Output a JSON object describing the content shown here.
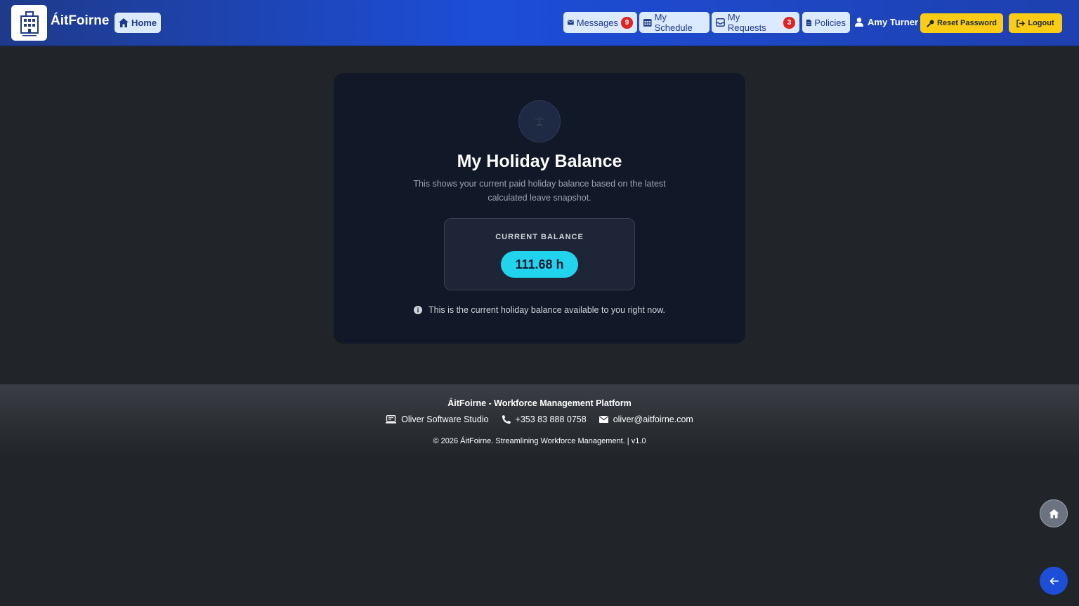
{
  "app": {
    "brand": "ÁitFoirne"
  },
  "nav": {
    "home_label": "Home",
    "messages_label": "Messages",
    "messages_count": "9",
    "schedule_label": "My Schedule",
    "requests_label": "My Requests",
    "requests_count": "3",
    "policies_label": "Policies",
    "user_name": "Amy Turner",
    "reset_password_label": "Reset Password",
    "logout_label": "Logout"
  },
  "card": {
    "icon": "island-palm-icon",
    "title": "My Holiday Balance",
    "subtitle": "This shows your current paid holiday balance based on the latest calculated leave snapshot.",
    "balance_label": "CURRENT BALANCE",
    "balance_value": "111.68 h",
    "note": "This is the current holiday balance available to you right now."
  },
  "footer": {
    "title": "ÁitFoirne - Workforce Management Platform",
    "company": "Oliver Software Studio",
    "phone": "+353 83 888 0758",
    "email": "oliver@aitfoirne.com",
    "copyright": "© 2026 ÁitFoirne. Streamlining Workforce Management. | v1.0"
  },
  "colors": {
    "nav_bg": "#1e40af",
    "accent_yellow": "#facc15",
    "balance_pill": "#22d3ee",
    "badge_red": "#dc2626",
    "page_bg": "#212529",
    "card_bg": "#111827"
  }
}
